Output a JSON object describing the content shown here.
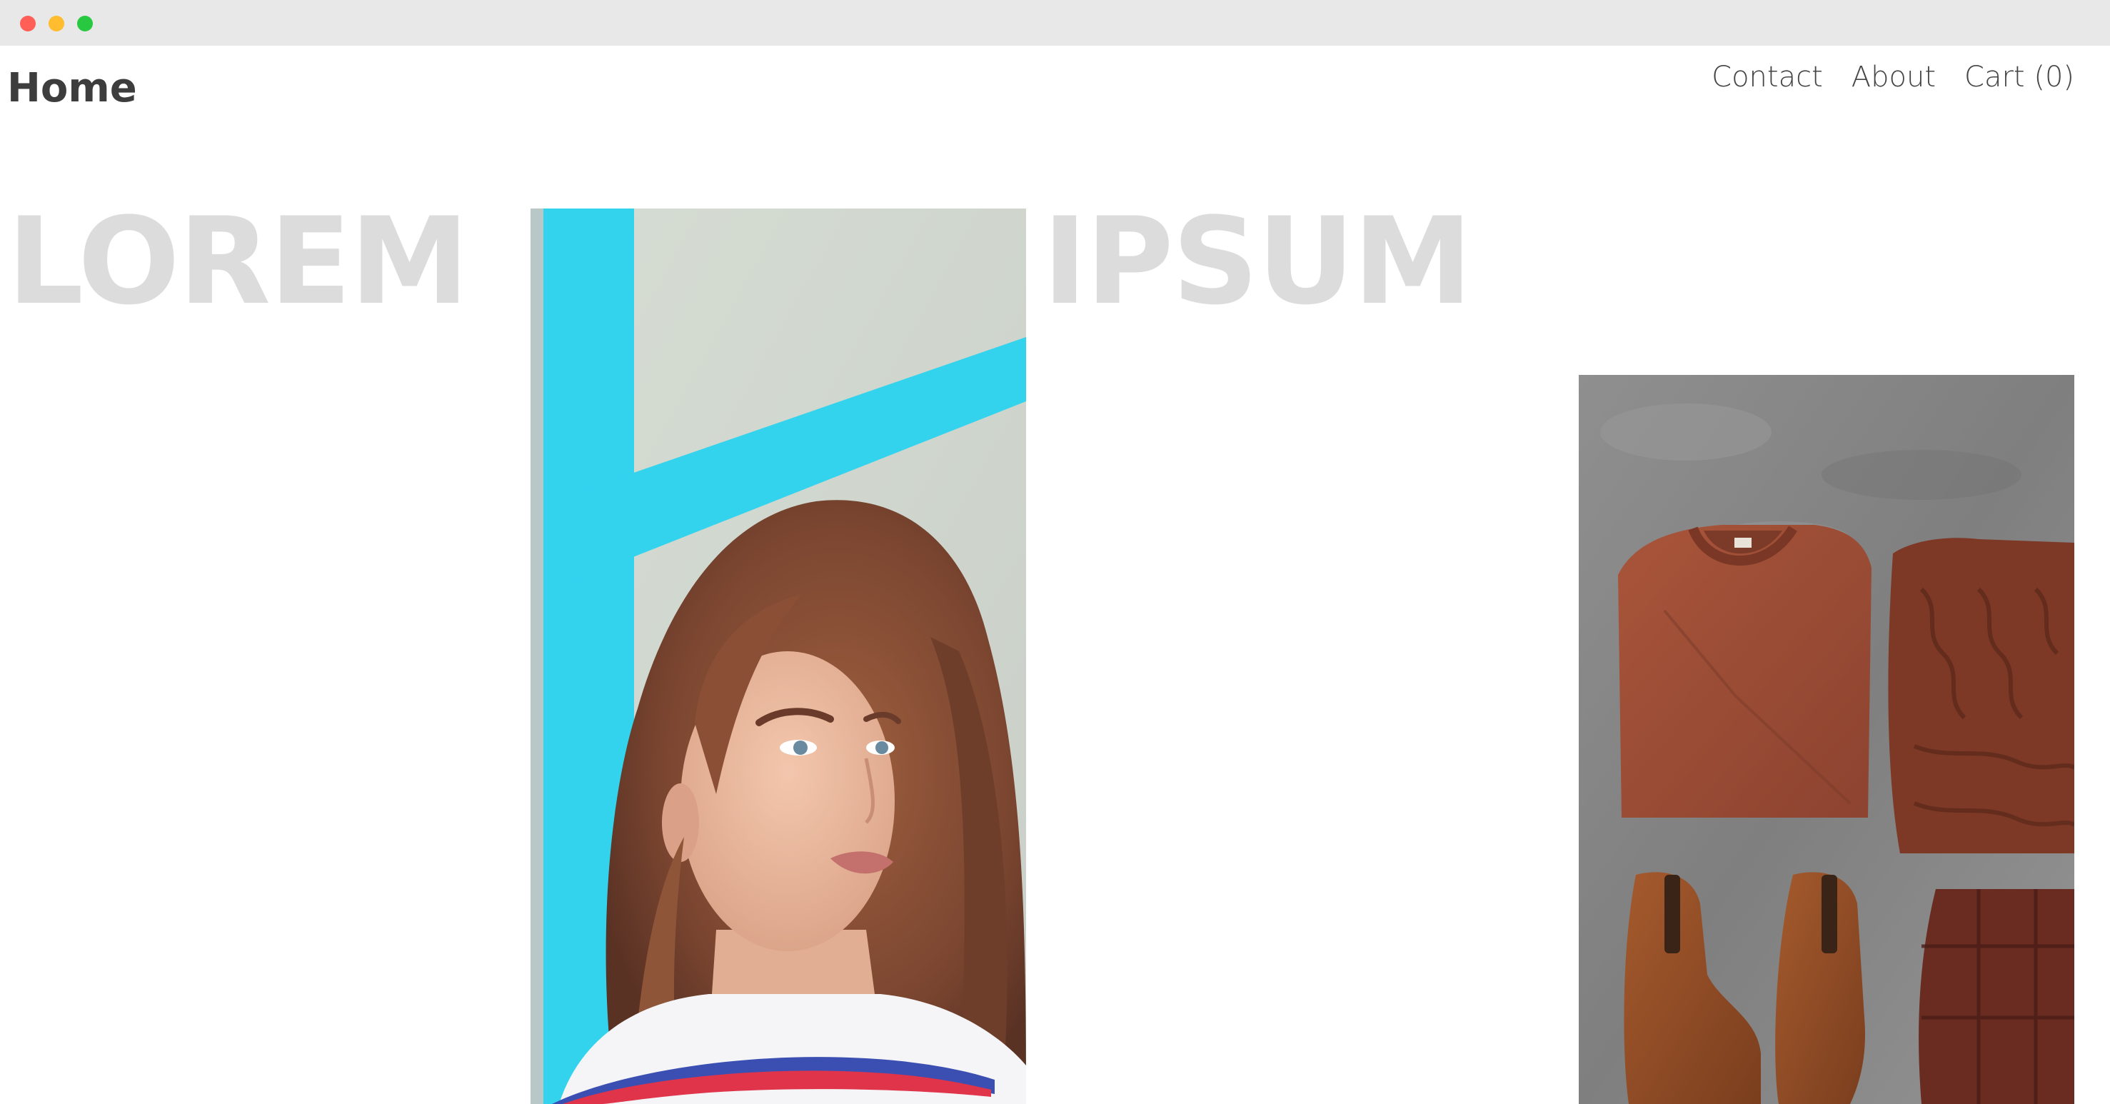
{
  "window": {
    "controls": [
      "close",
      "minimize",
      "zoom"
    ]
  },
  "header": {
    "title": "Home",
    "nav": [
      {
        "label": "Contact"
      },
      {
        "label": "About"
      },
      {
        "label": "Cart (0)"
      }
    ]
  },
  "hero": {
    "word_left": "LOREM",
    "word_right": "IPSUM"
  },
  "colors": {
    "hero_text": "#dcdcdc",
    "nav_text": "#454545",
    "title_text": "#3d3d3d",
    "accent_frame": "#33d3ee",
    "clothing_rust": "#9a4a30",
    "backdrop_gray": "#8a8a8a"
  },
  "images": [
    {
      "name": "model-portrait-photo",
      "icon": "photo-icon"
    },
    {
      "name": "clothing-flatlay-photo",
      "icon": "photo-icon"
    }
  ]
}
